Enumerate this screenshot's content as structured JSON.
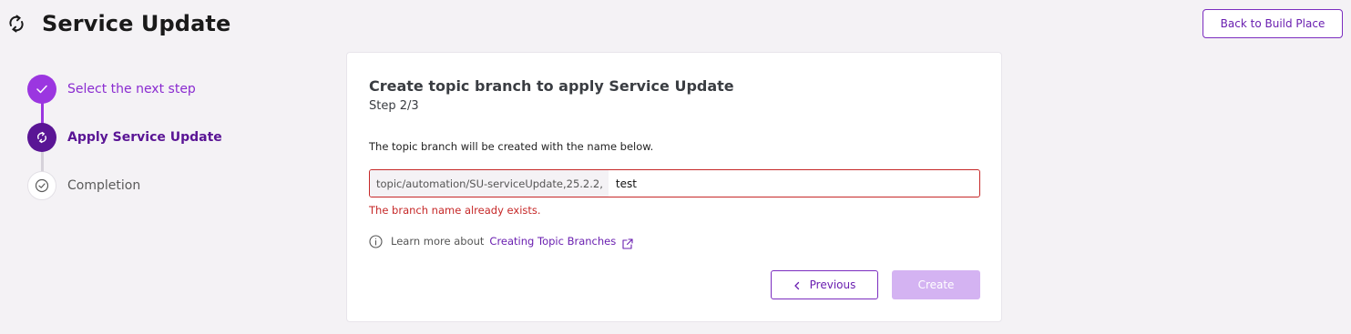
{
  "header": {
    "title": "Service Update",
    "title_icon": "refresh-icon",
    "back_button_label": "Back to Build Place"
  },
  "stepper": {
    "steps": [
      {
        "label": "Select the next step",
        "status": "completed",
        "icon": "check-icon"
      },
      {
        "label": "Apply Service Update",
        "status": "active",
        "icon": "refresh-icon"
      },
      {
        "label": "Completion",
        "status": "pending",
        "icon": "check-circle-icon"
      }
    ]
  },
  "card": {
    "title": "Create topic branch to apply Service Update",
    "step_text": "Step 2/3",
    "description": "The topic branch will be created with the name below.",
    "branch_prefix": "topic/automation/SU-serviceUpdate,25.2.2,",
    "branch_value": "test",
    "error_message": "The branch name already exists.",
    "learn_more_text": "Learn more about",
    "learn_more_link": "Creating Topic Branches",
    "previous_label": "Previous",
    "create_label": "Create"
  },
  "colors": {
    "accent": "#7b2cbf",
    "active_step": "#5a1595",
    "completed_step": "#9b36e0",
    "error": "#c62828",
    "disabled_button": "#d4b3f2",
    "background": "#f4f2f5"
  }
}
